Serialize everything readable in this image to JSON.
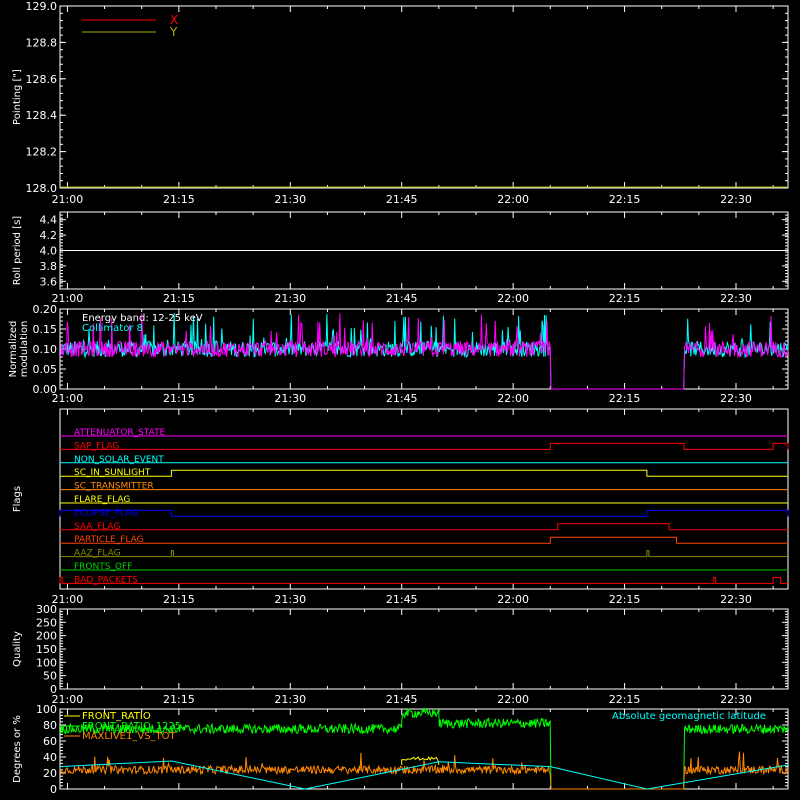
{
  "x_tick_labels": [
    "21:00",
    "21:15",
    "21:30",
    "21:45",
    "22:00",
    "22:15",
    "22:30"
  ],
  "chart_data": [
    {
      "type": "line",
      "ylabel": "Pointing [\"]",
      "ylim": [
        128.0,
        129.0
      ],
      "y_ticks": [
        "128.0",
        "128.2",
        "128.4",
        "128.6",
        "128.8",
        "129.0"
      ],
      "legend": [
        {
          "label": "X",
          "color": "#ff0000"
        },
        {
          "label": "Y",
          "color": "#aaaa00"
        }
      ],
      "series": [
        {
          "name": "X",
          "color": "#ff0000",
          "constant": 128.0
        },
        {
          "name": "Y",
          "color": "#aaaa00",
          "constant": 128.0
        }
      ]
    },
    {
      "type": "line",
      "ylabel": "Roll period [s]",
      "ylim": [
        3.5,
        4.5
      ],
      "y_ticks": [
        "3.6",
        "3.8",
        "4.0",
        "4.2",
        "4.4"
      ],
      "series": [
        {
          "name": "",
          "color": "#ffffff",
          "constant": 4.0
        }
      ]
    },
    {
      "type": "line",
      "ylabel": "Normalized modulation",
      "ylim": [
        0.0,
        0.2
      ],
      "y_ticks": [
        "0.00",
        "0.05",
        "0.10",
        "0.15",
        "0.20"
      ],
      "annotations": [
        "Energy band: 12-25 keV",
        "Collimator 8"
      ],
      "series": [
        {
          "name": "",
          "color": "#00ffff",
          "segments": [
            [
              0.0,
              0.1
            ],
            [
              0.0,
              0.1
            ]
          ],
          "baseline": 0.1
        },
        {
          "name": "",
          "color": "#ff00ff",
          "baseline": 0.1
        }
      ],
      "data_on": [
        [
          "20:59",
          "22:05"
        ],
        [
          "22:23",
          "22:37"
        ]
      ]
    },
    {
      "type": "line",
      "ylabel": "Flags",
      "flags": [
        {
          "label": "ATTENUATOR_STATE",
          "color": "#ff00ff",
          "high": []
        },
        {
          "label": "SAP_FLAG",
          "color": "#ff0000",
          "high": [
            [
              "22:05",
              "22:23"
            ],
            [
              "22:35",
              "22:37"
            ]
          ]
        },
        {
          "label": "NON_SOLAR_EVENT",
          "color": "#00ffff",
          "high": []
        },
        {
          "label": "SC_IN_SUNLIGHT",
          "color": "#ffff00",
          "high": [
            [
              "21:14",
              "22:18"
            ]
          ],
          "inverted": false
        },
        {
          "label": "SC_TRANSMITTER",
          "color": "#ff8800",
          "high": []
        },
        {
          "label": "FLARE_FLAG",
          "color": "#ffff00",
          "high": []
        },
        {
          "label": "ECLIPSE_FLAG",
          "color": "#0000ff",
          "high": [
            [
              "20:59",
              "21:14"
            ],
            [
              "22:18",
              "22:37"
            ]
          ]
        },
        {
          "label": "SAA_FLAG",
          "color": "#ff0000",
          "high": [
            [
              "22:06",
              "22:21"
            ]
          ]
        },
        {
          "label": "PARTICLE_FLAG",
          "color": "#ff4400",
          "high": [
            [
              "22:05",
              "22:22"
            ]
          ]
        },
        {
          "label": "AAZ_FLAG",
          "color": "#888800",
          "high": [
            [
              "21:14",
              "21:14"
            ],
            [
              "22:18",
              "22:18"
            ]
          ]
        },
        {
          "label": "FRONTS_OFF",
          "color": "#00cc00",
          "high": []
        },
        {
          "label": "BAD_PACKETS",
          "color": "#ff0000",
          "high": [
            [
              "20:59",
              "20:59"
            ],
            [
              "22:27",
              "22:27"
            ],
            [
              "22:35",
              "22:36"
            ]
          ]
        }
      ]
    },
    {
      "type": "line",
      "ylabel": "Quality",
      "ylim": [
        0,
        300
      ],
      "y_ticks": [
        "0",
        "50",
        "100",
        "150",
        "200",
        "250",
        "300"
      ],
      "series": []
    },
    {
      "type": "line",
      "ylabel": "Degrees or %",
      "ylim": [
        0,
        100
      ],
      "y_ticks": [
        "0",
        "20",
        "40",
        "60",
        "80",
        "100"
      ],
      "legend": [
        {
          "label": "FRONT_RATIO",
          "color": "#ffff00"
        },
        {
          "label": "FRONT_RATIO_1225",
          "color": "#00ff00"
        },
        {
          "label": "MAXLIVE1_VS_TOT",
          "color": "#ff8800"
        }
      ],
      "right_label": {
        "label": "Absolute geomagnetic latitude",
        "color": "#00ffff"
      },
      "series": [
        {
          "name": "FRONT_RATIO",
          "color": "#ffff00",
          "points": [
            [
              "21:45",
              38
            ],
            [
              "21:50",
              38
            ]
          ]
        },
        {
          "name": "FRONT_RATIO_1225",
          "color": "#00ff00",
          "baseline": 75,
          "segments": [
            [
              "20:59",
              "21:45",
              75
            ],
            [
              "21:45",
              "21:50",
              95
            ],
            [
              "21:50",
              "22:05",
              82
            ],
            [
              "22:23",
              "22:37",
              75
            ]
          ]
        },
        {
          "name": "MAXLIVE1_VS_TOT",
          "color": "#ff8800",
          "baseline": 24,
          "segments": [
            [
              "20:59",
              "22:05"
            ],
            [
              "22:23",
              "22:37"
            ]
          ]
        },
        {
          "name": "Absolute geomagnetic latitude",
          "color": "#00ffff",
          "points": [
            [
              "20:59",
              28
            ],
            [
              "21:14",
              35
            ],
            [
              "21:32",
              0
            ],
            [
              "21:50",
              34
            ],
            [
              "22:05",
              28
            ],
            [
              "22:18",
              0
            ],
            [
              "22:37",
              30
            ]
          ]
        }
      ]
    }
  ]
}
